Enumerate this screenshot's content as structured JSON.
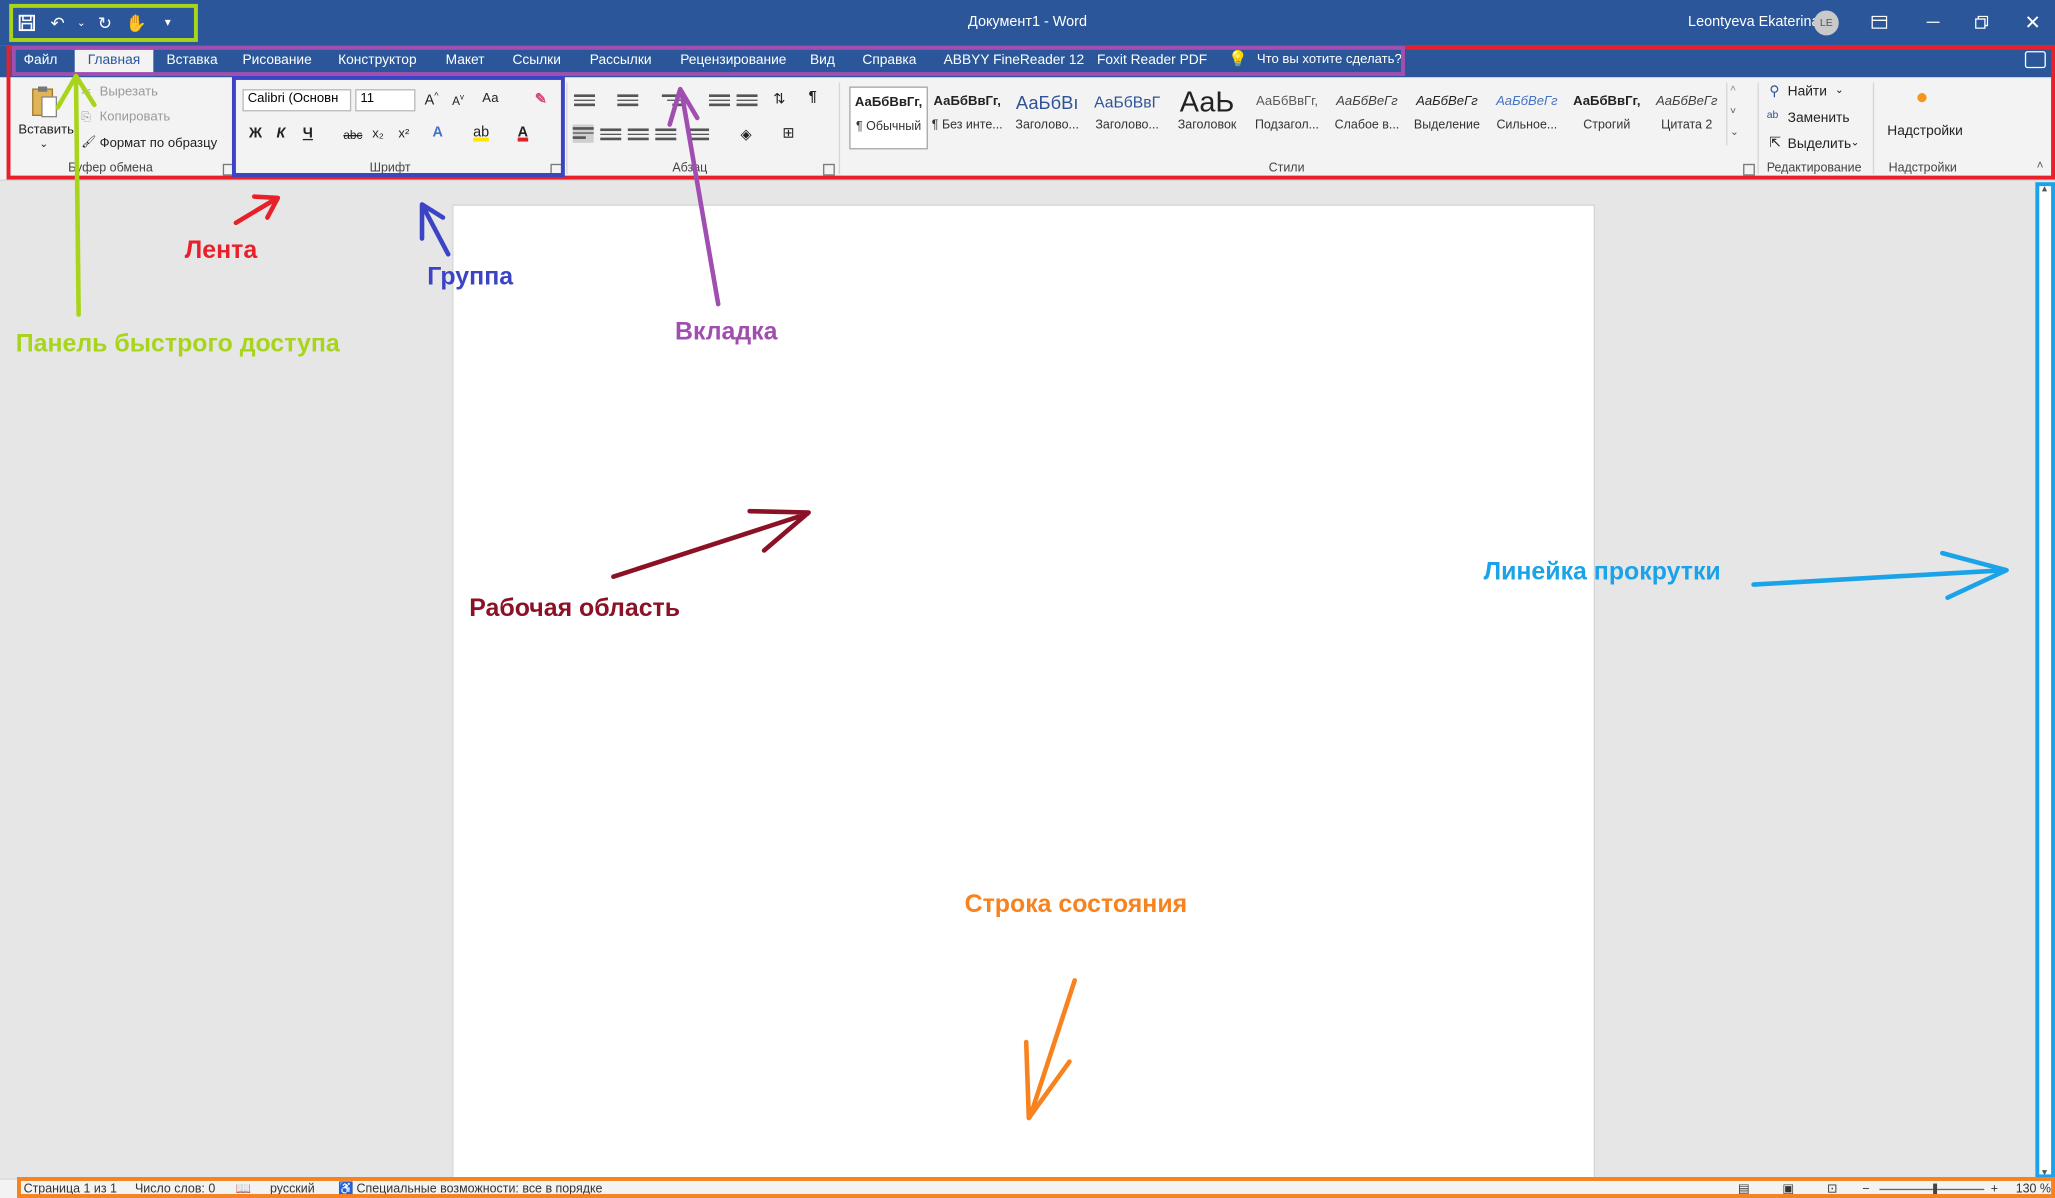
{
  "window": {
    "title": "Документ1  -  Word",
    "user": "Leontyeva Ekaterina",
    "user_initials": "LE"
  },
  "qat_icons": [
    "save-icon",
    "undo-icon",
    "undo-dropdown-icon",
    "redo-icon",
    "touch-mode-icon",
    "customize-qat-icon"
  ],
  "tabs": [
    {
      "label": "Файл"
    },
    {
      "label": "Главная"
    },
    {
      "label": "Вставка"
    },
    {
      "label": "Рисование"
    },
    {
      "label": "Конструктор"
    },
    {
      "label": "Макет"
    },
    {
      "label": "Ссылки"
    },
    {
      "label": "Рассылки"
    },
    {
      "label": "Рецензирование"
    },
    {
      "label": "Вид"
    },
    {
      "label": "Справка"
    },
    {
      "label": "ABBYY FineReader 12"
    },
    {
      "label": "Foxit Reader PDF"
    }
  ],
  "tell_me": "Что вы хотите сделать?",
  "clipboard": {
    "paste": "Вставить",
    "cut": "Вырезать",
    "copy": "Копировать",
    "format_painter": "Формат по образцу",
    "group_label": "Буфер обмена"
  },
  "font": {
    "family": "Calibri (Основн",
    "size": "11",
    "case_label": "Аа",
    "bold": "Ж",
    "italic": "К",
    "underline": "Ч",
    "strike": "abc",
    "subscript": "x₂",
    "superscript": "x²",
    "group_label": "Шрифт"
  },
  "paragraph": {
    "group_label": "Абзац"
  },
  "styles": {
    "group_label": "Стили",
    "items": [
      {
        "preview": "АаБбВвГг,",
        "name": "¶ Обычный"
      },
      {
        "preview": "АаБбВвГг,",
        "name": "¶ Без инте..."
      },
      {
        "preview": "АаБбВı",
        "name": "Заголово..."
      },
      {
        "preview": "АаБбВвГ",
        "name": "Заголово..."
      },
      {
        "preview": "АаЬ",
        "name": "Заголовок"
      },
      {
        "preview": "АаБбВвГг,",
        "name": "Подзагол..."
      },
      {
        "preview": "АаБбВеГг",
        "name": "Слабое в..."
      },
      {
        "preview": "АаБбВеГг",
        "name": "Выделение"
      },
      {
        "preview": "АаБбВеГг",
        "name": "Сильное..."
      },
      {
        "preview": "АаБбВвГг,",
        "name": "Строгий"
      },
      {
        "preview": "АаБбВеГг",
        "name": "Цитата 2"
      }
    ]
  },
  "editing": {
    "find": "Найти",
    "replace": "Заменить",
    "select": "Выделить",
    "group_label": "Редактирование"
  },
  "addins": {
    "button": "Надстройки",
    "group_label": "Надстройки"
  },
  "status": {
    "page": "Страница 1 из 1",
    "words": "Число слов: 0",
    "language": "русский",
    "accessibility": "Специальные возможности: все в порядке",
    "zoom": "130 %"
  },
  "annotations": {
    "ribbon": "Лента",
    "group": "Группа",
    "tab": "Вкладка",
    "qat": "Панель быстрого доступа",
    "workspace": "Рабочая область",
    "scrollbar": "Линейка прокрутки",
    "statusbar": "Строка состояния"
  },
  "colors": {
    "word_blue": "#2b579a",
    "ribbon_box": "#e8202a",
    "group_box": "#3b44c4",
    "tab_box": "#a04fb0",
    "qat_box": "#a8d51c",
    "workspace_label": "#8b1226",
    "scroll_box": "#1aa3e8",
    "status_box": "#f7821e"
  }
}
